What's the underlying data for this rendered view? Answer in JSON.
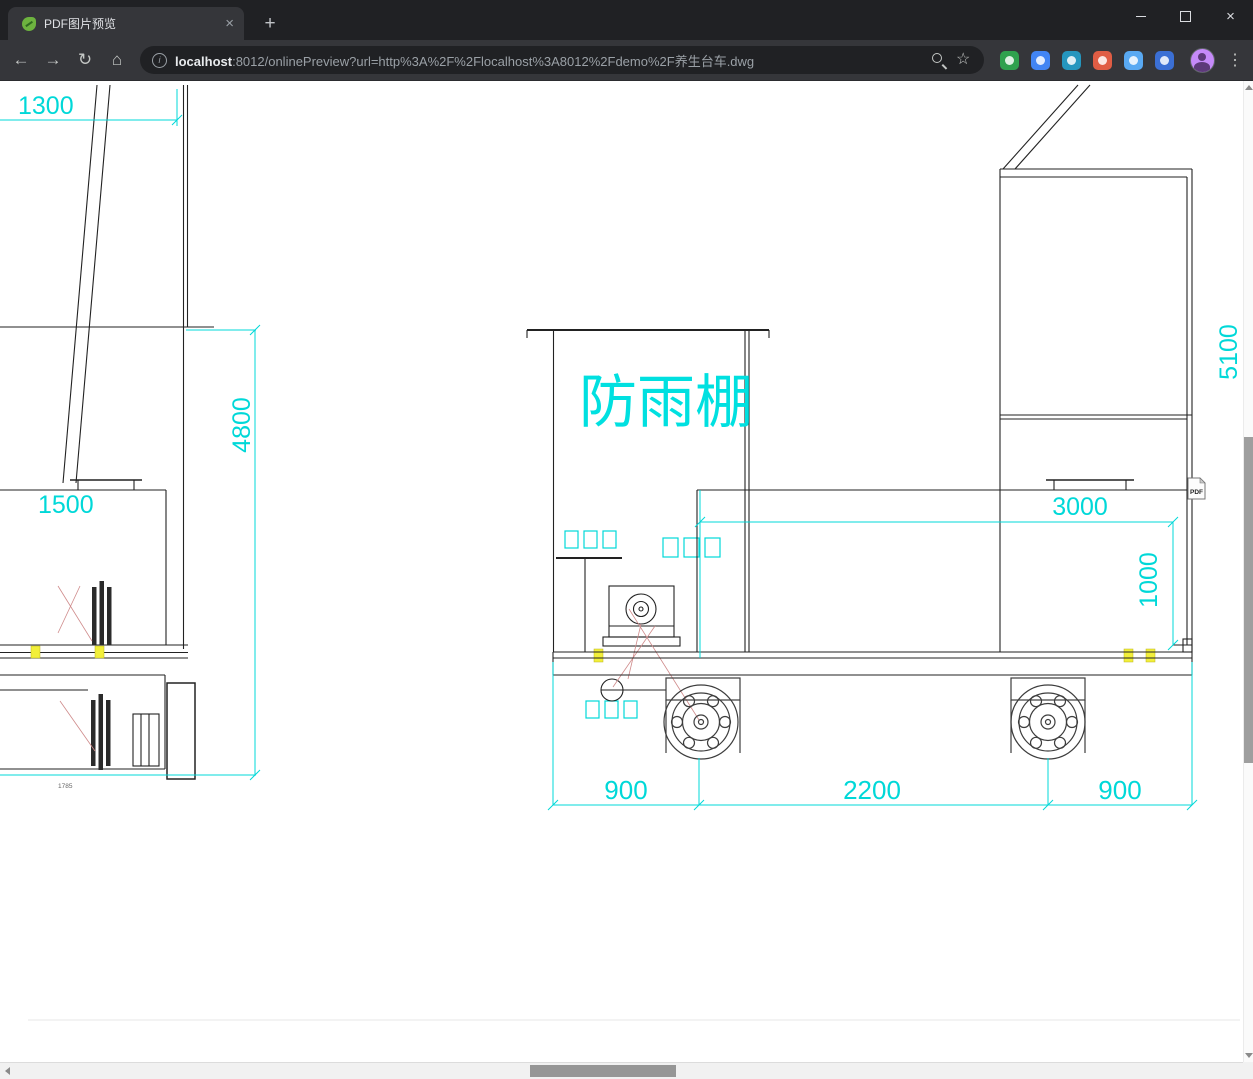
{
  "browser": {
    "tab_title": "PDF图片预览",
    "icons": {
      "tab_close": "×",
      "new_tab": "+",
      "back": "←",
      "forward": "→",
      "reload": "↻",
      "home": "⌂",
      "info": "i",
      "star": "☆",
      "menu": "⋮",
      "window_close": "×"
    },
    "address": {
      "host": "localhost",
      "path": ":8012/onlinePreview?url=http%3A%2F%2Flocalhost%3A8012%2Fdemo%2F养生台车.dwg"
    },
    "theme": {
      "titlebar_bg": "#202124",
      "toolbar_bg": "#35363a",
      "omnibox_bg": "#202124",
      "extension_colors": [
        "#30a14e",
        "#4285f4",
        "#2596be",
        "#e05d44",
        "#59a9f2",
        "#3b6fd4"
      ],
      "avatar_color": "#c58af9"
    }
  },
  "drawing": {
    "shelter_label": "防雨棚",
    "pdf_badge": "PDF",
    "accent_cyan": "#00d8d8",
    "dimensions": {
      "top_width": "1300",
      "mast_height": "4800",
      "base_width": "1500",
      "base_detail": "1785",
      "frame_height": "5100",
      "platform_length": "3000",
      "platform_height": "1000",
      "span_left": "900",
      "wheelbase": "2200",
      "span_right": "900"
    }
  }
}
